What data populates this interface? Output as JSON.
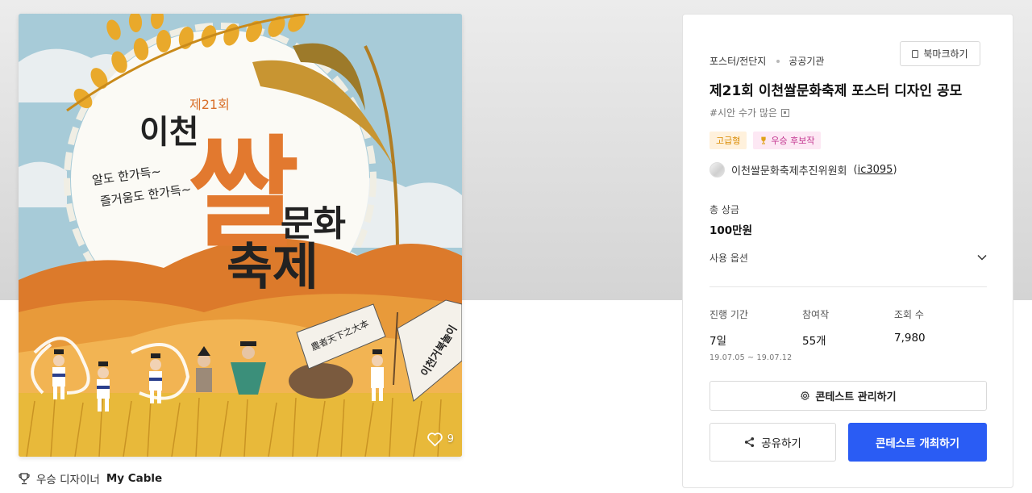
{
  "poster": {
    "round_text": "제21회",
    "city_text": "이천",
    "rice_text": "쌀",
    "culture_text": "문화",
    "festival_text": "축제",
    "slogan_line1": "알도 한가득~",
    "slogan_line2": "즐거움도 한가득~",
    "banner_left": "農者天下之大本",
    "banner_right": "이천거북놀이",
    "likes": "9"
  },
  "winner": {
    "label": "우승 디자이너",
    "name": "My Cable"
  },
  "panel": {
    "category": "포스터/전단지",
    "org_type": "공공기관",
    "bookmark_label": "북마크하기",
    "title": "제21회 이천쌀문화축제 포스터 디자인 공모",
    "tags": "#시안 수가 많은",
    "badge_grade": "고급형",
    "badge_prize": "우승 후보작",
    "host_name": "이천쌀문화축제추진위원회",
    "host_id": "ic3095",
    "prize_label": "총 상금",
    "prize_value": "100만원",
    "usage_label": "사용 옵션",
    "stats": {
      "period_label": "진행 기간",
      "period_value": "7일",
      "period_dates": "19.07.05 ~ 19.07.12",
      "entries_label": "참여작",
      "entries_value": "55개",
      "views_label": "조회 수",
      "views_value": "7,980"
    },
    "manage_label": "콘테스트 관리하기",
    "share_label": "공유하기",
    "host_contest_label": "콘테스트 개최하기"
  },
  "colors": {
    "accent": "#2a5cf4",
    "badge_grade_bg": "#fff1dc",
    "badge_grade_text": "#d98a00",
    "badge_prize_bg": "#fde8f4",
    "badge_prize_text": "#c2358f"
  }
}
